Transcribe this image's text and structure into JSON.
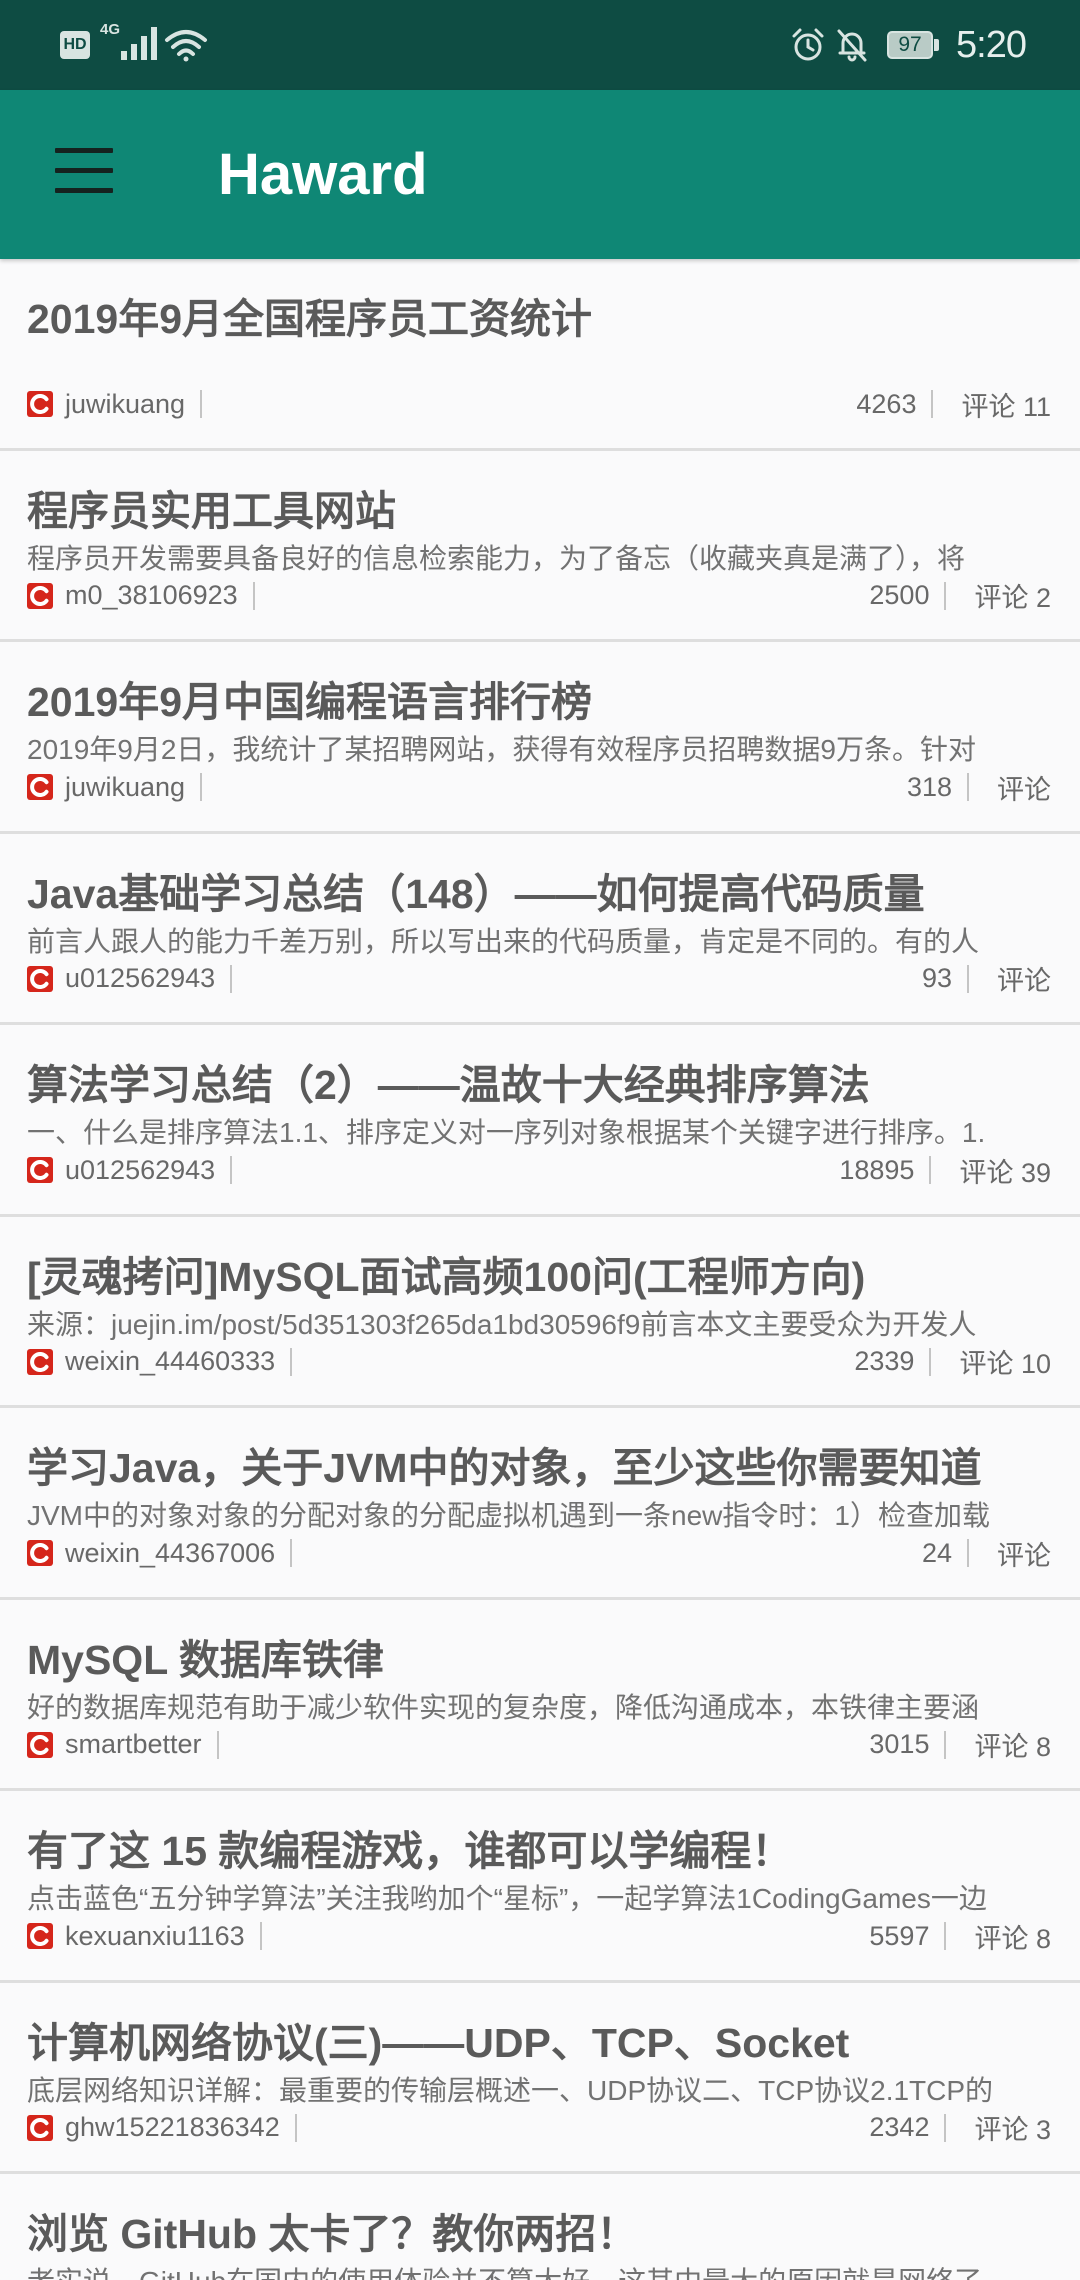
{
  "status_bar": {
    "hd_label": "HD",
    "network_type": "4G",
    "battery_level": "97",
    "time": "5:20",
    "left_icons": [
      "signal-icon",
      "wifi-icon"
    ],
    "right_icons": [
      "alarm-icon",
      "bell-off-icon",
      "battery-icon"
    ]
  },
  "app_bar": {
    "title": "Haward",
    "menu_icon": "hamburger-menu-icon"
  },
  "article_icon": "csdn-logo-icon",
  "articles": [
    {
      "title": "2019年9月全国程序员工资统计",
      "summary": "",
      "author": "juwikuang",
      "views": "4263",
      "comments": "评论 11"
    },
    {
      "title": "程序员实用工具网站",
      "summary": "程序员开发需要具备良好的信息检索能力，为了备忘（收藏夹真是满了），将",
      "author": "m0_38106923",
      "views": "2500",
      "comments": "评论 2"
    },
    {
      "title": "2019年9月中国编程语言排行榜",
      "summary": "2019年9月2日，我统计了某招聘网站，获得有效程序员招聘数据9万条。针对",
      "author": "juwikuang",
      "views": "318",
      "comments": "评论"
    },
    {
      "title": "Java基础学习总结（148）——如何提高代码质量",
      "summary": "前言人跟人的能力千差万别，所以写出来的代码质量，肯定是不同的。有的人",
      "author": "u012562943",
      "views": "93",
      "comments": "评论"
    },
    {
      "title": "算法学习总结（2）——温故十大经典排序算法",
      "summary": "一、什么是排序算法1.1、排序定义对一序列对象根据某个关键字进行排序。1.",
      "author": "u012562943",
      "views": "18895",
      "comments": "评论 39"
    },
    {
      "title": "[灵魂拷问]MySQL面试高频100问(工程师方向)",
      "summary": "来源：juejin.im/post/5d351303f265da1bd30596f9前言本文主要受众为开发人",
      "author": "weixin_44460333",
      "views": "2339",
      "comments": "评论 10"
    },
    {
      "title": "学习Java，关于JVM中的对象，至少这些你需要知道",
      "summary": "JVM中的对象对象的分配对象的分配虚拟机遇到一条new指令时：1）检查加载",
      "author": "weixin_44367006",
      "views": "24",
      "comments": "评论"
    },
    {
      "title": "MySQL 数据库铁律",
      "summary": "好的数据库规范有助于减少软件实现的复杂度，降低沟通成本，本铁律主要涵",
      "author": "smartbetter",
      "views": "3015",
      "comments": "评论 8"
    },
    {
      "title": "有了这 15 款编程游戏，谁都可以学编程！",
      "summary": "点击蓝色“五分钟学算法”关注我哟加个“星标”，一起学算法1CodingGames一边",
      "author": "kexuanxiu1163",
      "views": "5597",
      "comments": "评论 8"
    },
    {
      "title": "计算机网络协议(三)——UDP、TCP、Socket",
      "summary": "底层网络知识详解：最重要的传输层概述一、UDP协议二、TCP协议2.1TCP的",
      "author": "ghw15221836342",
      "views": "2342",
      "comments": "评论 3"
    },
    {
      "title": "浏览 GitHub 太卡了？教你两招！",
      "summary": "老实说，GitHub在国内的使用体验并不算太好，这其中最大的原因就是网络了"
    }
  ],
  "colors": {
    "status_bar": "#0e4c43",
    "app_bar": "#0f8775",
    "title_text": "#5a5a5a",
    "summary_text": "#727272",
    "meta_text": "#686868",
    "logo_red": "#d5261b",
    "list_background": "#fafafb",
    "divider": "#dedede",
    "status_icons": "#d8e4e1"
  }
}
